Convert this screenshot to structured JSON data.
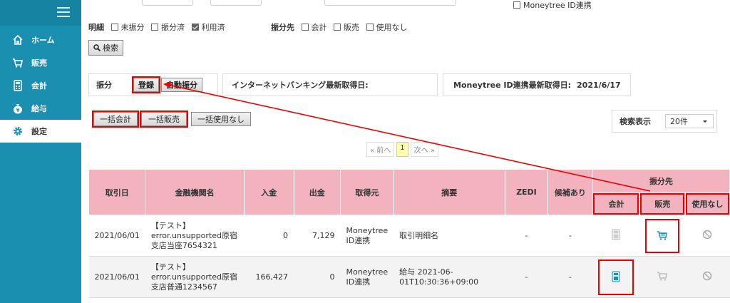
{
  "sidebar": {
    "items": [
      {
        "label": "ホーム",
        "icon": "home-icon"
      },
      {
        "label": "販売",
        "icon": "cart-icon"
      },
      {
        "label": "会計",
        "icon": "calculator-icon"
      },
      {
        "label": "給与",
        "icon": "money-bag-icon"
      },
      {
        "label": "設定",
        "icon": "gear-icon"
      }
    ]
  },
  "filters": {
    "moneytree_label": "Moneytree ID連携",
    "detail_label": "明細",
    "detail_options": [
      {
        "label": "未振分",
        "checked": false
      },
      {
        "label": "振分済",
        "checked": false
      },
      {
        "label": "利用済",
        "checked": true
      }
    ],
    "dest_label": "振分先",
    "dest_options": [
      {
        "label": "会計",
        "checked": false
      },
      {
        "label": "販売",
        "checked": false
      },
      {
        "label": "使用なし",
        "checked": false
      }
    ],
    "search_button": "検索"
  },
  "sorting": {
    "label": "振分",
    "register_button": "登録",
    "auto_button": "自動振分",
    "netbank_label": "インターネットバンキング最新取得日:",
    "moneytree_label": "Moneytree ID連携最新取得日:",
    "moneytree_date": "2021/6/17"
  },
  "bulk": {
    "accounting": "一括会計",
    "sales": "一括販売",
    "unused": "一括使用なし"
  },
  "pager": {
    "prev": "« 前へ",
    "current": "1",
    "next": "次へ »"
  },
  "per_page": {
    "label": "検索表示",
    "value": "20件"
  },
  "table": {
    "headers": {
      "date": "取引日",
      "bank": "金融機関名",
      "deposit": "入金",
      "withdraw": "出金",
      "source": "取得元",
      "summary": "摘要",
      "zedi": "ZEDI",
      "candidate": "候補あり",
      "dest": "振分先",
      "dest_accounting": "会計",
      "dest_sales": "販売",
      "dest_unused": "使用なし"
    },
    "rows": [
      {
        "date": "2021/06/01",
        "bank_line1": "【テスト】",
        "bank_line2": "error.unsupported原宿",
        "bank_line3": "支店当座7654321",
        "deposit": "0",
        "withdraw": "7,129",
        "source_line1": "Moneytree",
        "source_line2": "ID連携",
        "summary_line1": "取引明細名",
        "summary_line2": "",
        "zedi": "-",
        "candidate": "-"
      },
      {
        "date": "2021/06/01",
        "bank_line1": "【テスト】",
        "bank_line2": "error.unsupported原宿",
        "bank_line3": "支店普通1234567",
        "deposit": "166,427",
        "withdraw": "0",
        "source_line1": "Moneytree",
        "source_line2": "ID連携",
        "summary_line1": "給与 2021-06-",
        "summary_line2": "01T10:30:36+09:00",
        "zedi": "-",
        "candidate": "-"
      }
    ]
  },
  "colors": {
    "sidebar": "#1a8fb0",
    "table_header": "#f2b3bf",
    "highlight": "#e00000",
    "icon_active": "#1a8fb0"
  }
}
